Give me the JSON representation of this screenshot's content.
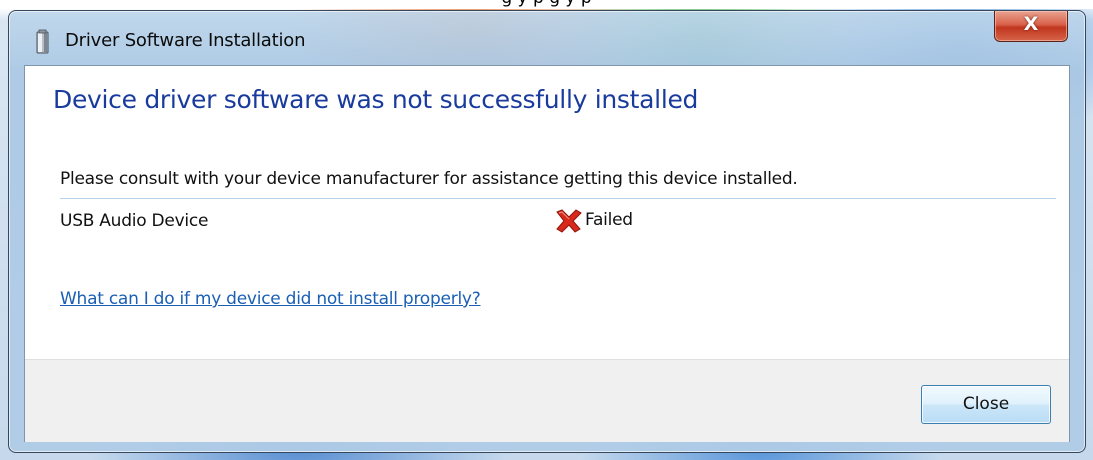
{
  "background_text": "g                y p    g         y                                   p",
  "window": {
    "title": "Driver Software Installation",
    "close_glyph": "X"
  },
  "dialog": {
    "heading": "Device driver software was not successfully installed",
    "message": "Please consult with your device manufacturer for assistance getting this device installed.",
    "device": {
      "name": "USB Audio Device",
      "status": "Failed",
      "status_icon": "red-x-icon"
    },
    "help_link": "What can I do if my device did not install properly?",
    "close_button": "Close"
  },
  "colors": {
    "heading": "#1a3b9e",
    "link": "#1a5fb4",
    "fail_icon": "#d8291c"
  }
}
